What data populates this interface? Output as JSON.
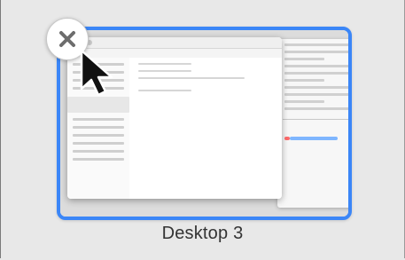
{
  "desktop": {
    "label": "Desktop 3",
    "selected": true
  },
  "close_button": {
    "icon": "close-icon"
  },
  "cursor": {
    "icon": "arrow-cursor-icon"
  },
  "colors": {
    "selection_border": "#3b86f7",
    "background": "#e8e8e8"
  }
}
